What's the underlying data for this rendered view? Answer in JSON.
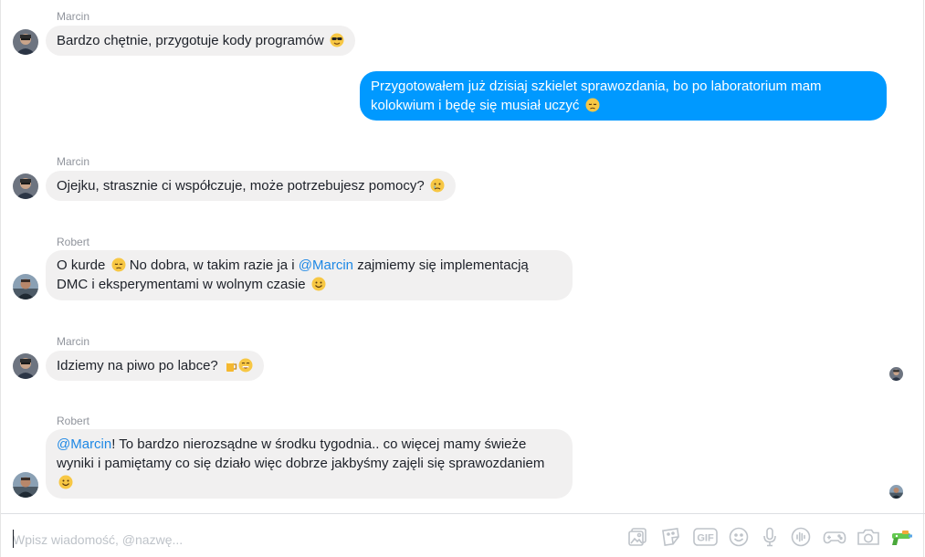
{
  "messages": [
    {
      "sender": "Marcin",
      "text": "Bardzo chętnie, przygotuje kody programów",
      "emoji": "sunglasses-face-emoji"
    },
    {
      "sender": "",
      "text": "Przygotowałem już dzisiaj szkielet sprawozdania, bo po laboratorium mam kolokwium i będę się musiał uczyć",
      "emoji": "disappointed-face-emoji"
    },
    {
      "sender": "Marcin",
      "text": "Ojejku, strasznie ci współczuje, może potrzebujesz pomocy?",
      "emoji": "crying-face-emoji"
    },
    {
      "sender": "Robert",
      "part1": "O kurde",
      "part2": "No dobra, w takim razie ja i",
      "mention": "@Marcin",
      "part3": "zajmiemy się implementacją DMC i eksperymentami w wolnym czasie",
      "emoji": "smiling-face-emoji"
    },
    {
      "sender": "Marcin",
      "text": "Idziemy na piwo po labce?",
      "emoji": "beer-and-grin-emoji"
    },
    {
      "sender": "Robert",
      "mention": "@Marcin",
      "text": "! To bardzo nierozsądne w środku tygodnia.. co więcej mamy świeże wyniki i pamiętamy co się działo więc dobrze jakbyśmy zajęli się sprawozdaniem",
      "emoji": "smiling-face-emoji"
    }
  ],
  "composer": {
    "placeholder": "Wpisz wiadomość, @nazwę..."
  },
  "toolbar": {
    "gif_label": "GIF",
    "icons": [
      "image-icon",
      "sticker-icon",
      "gif-icon",
      "emoji-icon",
      "microphone-icon",
      "voice-wave-icon",
      "game-controller-icon",
      "camera-icon",
      "water-gun-icon"
    ]
  },
  "colors": {
    "outgoing_bubble": "#0099ff",
    "incoming_bubble": "#f1f0f0",
    "mention": "#1e88e5",
    "sender_name": "#90949c",
    "toolbar_icon": "#bec3c9"
  }
}
